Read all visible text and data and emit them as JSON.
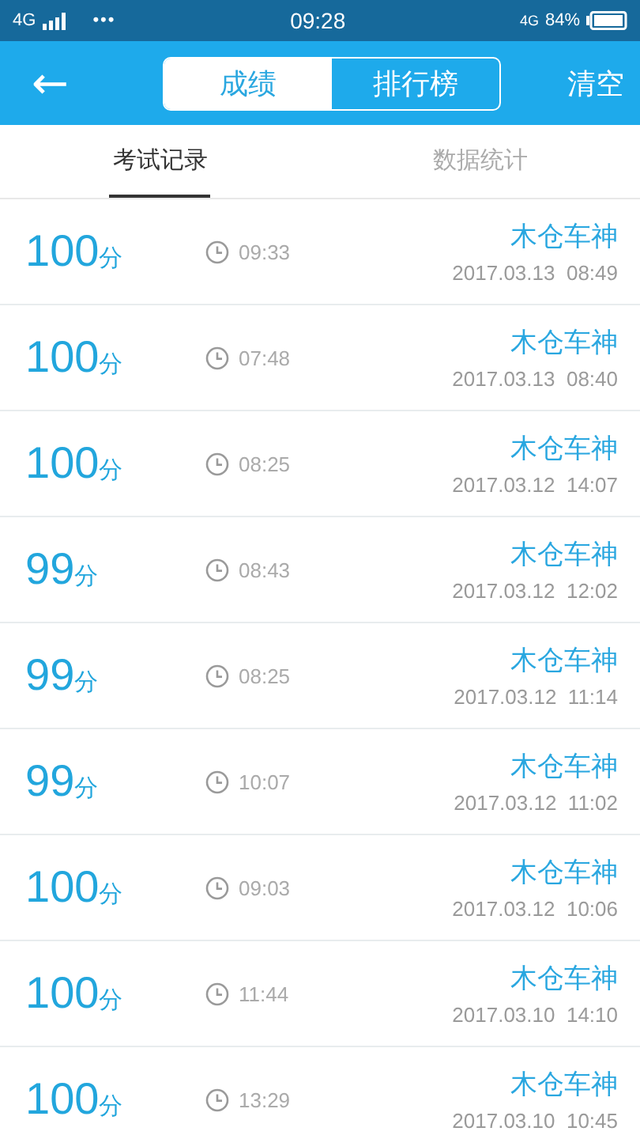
{
  "status_bar": {
    "network": "4G",
    "menu": "•••",
    "time": "09:28",
    "network_right": "4G",
    "battery": "84%"
  },
  "header": {
    "back": "←",
    "tabs": [
      {
        "label": "成绩",
        "selected": true
      },
      {
        "label": "排行榜",
        "selected": false
      }
    ],
    "action": "清空"
  },
  "sub_tabs": [
    {
      "label": "考试记录",
      "selected": true
    },
    {
      "label": "数据统计",
      "selected": false
    }
  ],
  "records": [
    {
      "score": "100",
      "unit": "分",
      "duration": "09:33",
      "name": "木仓车神",
      "date": "2017.03.13  08:49"
    },
    {
      "score": "100",
      "unit": "分",
      "duration": "07:48",
      "name": "木仓车神",
      "date": "2017.03.13  08:40"
    },
    {
      "score": "100",
      "unit": "分",
      "duration": "08:25",
      "name": "木仓车神",
      "date": "2017.03.12  14:07"
    },
    {
      "score": "99",
      "unit": "分",
      "duration": "08:43",
      "name": "木仓车神",
      "date": "2017.03.12  12:02"
    },
    {
      "score": "99",
      "unit": "分",
      "duration": "08:25",
      "name": "木仓车神",
      "date": "2017.03.12  11:14"
    },
    {
      "score": "99",
      "unit": "分",
      "duration": "10:07",
      "name": "木仓车神",
      "date": "2017.03.12  11:02"
    },
    {
      "score": "100",
      "unit": "分",
      "duration": "09:03",
      "name": "木仓车神",
      "date": "2017.03.12  10:06"
    },
    {
      "score": "100",
      "unit": "分",
      "duration": "11:44",
      "name": "木仓车神",
      "date": "2017.03.10  14:10"
    },
    {
      "score": "100",
      "unit": "分",
      "duration": "13:29",
      "name": "木仓车神",
      "date": "2017.03.10  10:45"
    }
  ]
}
